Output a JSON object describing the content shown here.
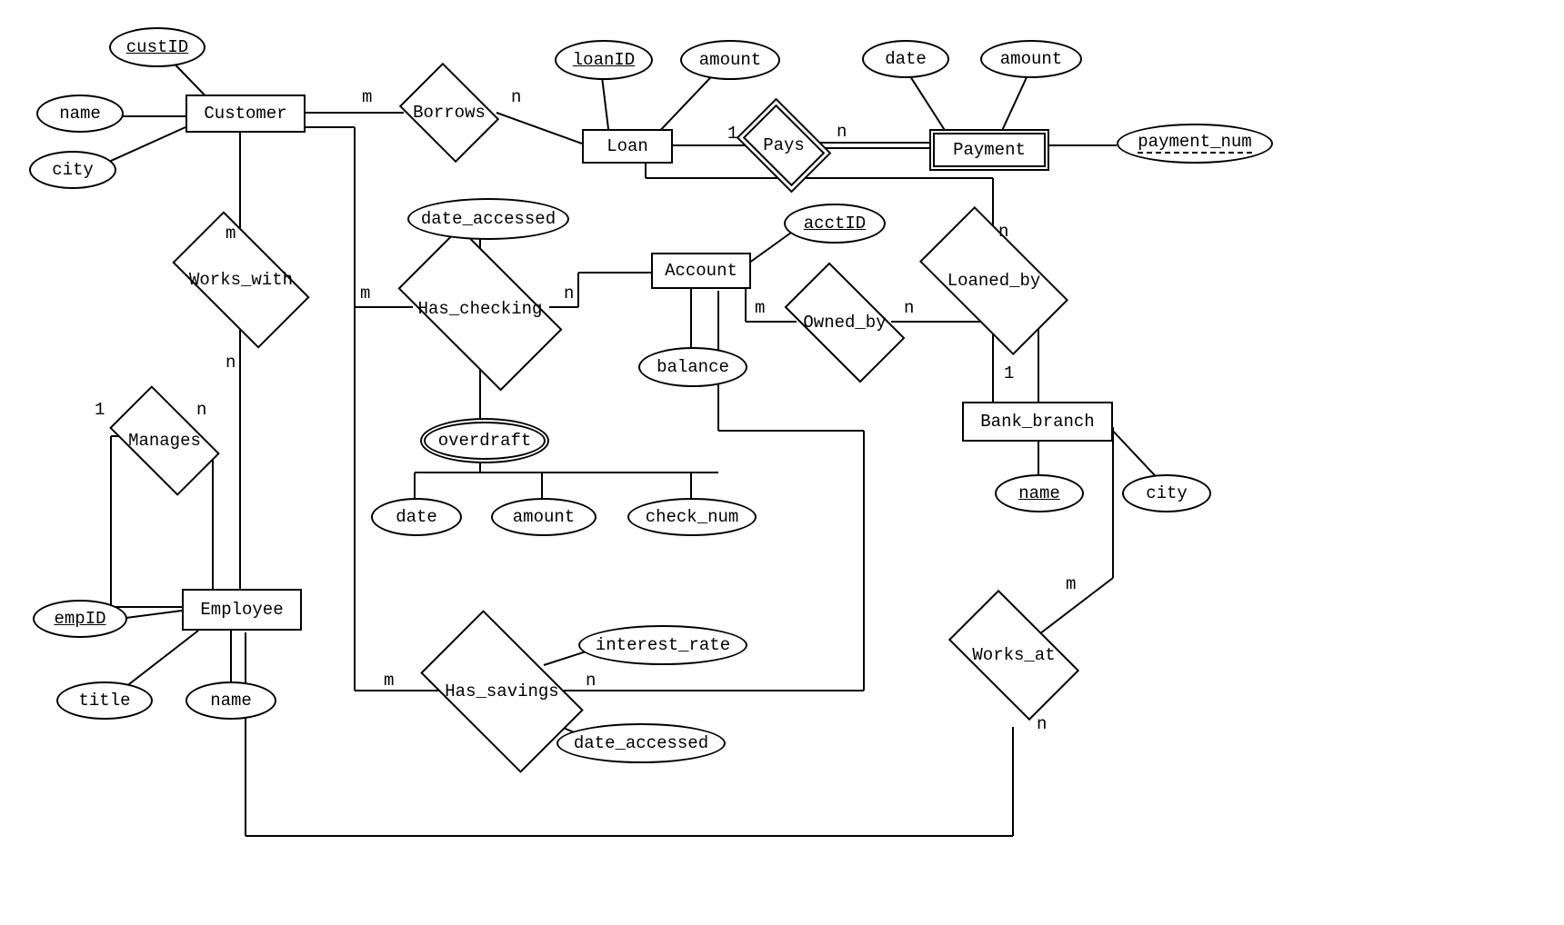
{
  "entities": {
    "customer": "Customer",
    "loan": "Loan",
    "payment": "Payment",
    "account": "Account",
    "bank_branch": "Bank_branch",
    "employee": "Employee"
  },
  "relationships": {
    "borrows": "Borrows",
    "pays": "Pays",
    "works_with": "Works_with",
    "has_checking": "Has_checking",
    "owned_by": "Owned_by",
    "loaned_by": "Loaned_by",
    "manages": "Manages",
    "has_savings": "Has_savings",
    "works_at": "Works_at"
  },
  "attributes": {
    "custID": "custID",
    "cust_name": "name",
    "cust_city": "city",
    "loanID": "loanID",
    "loan_amount": "amount",
    "pay_date": "date",
    "pay_amount": "amount",
    "payment_num": "payment_num",
    "checking_date_accessed": "date_accessed",
    "acctID": "acctID",
    "balance": "balance",
    "overdraft": "overdraft",
    "od_date": "date",
    "od_amount": "amount",
    "od_check_num": "check_num",
    "empID": "empID",
    "emp_title": "title",
    "emp_name": "name",
    "savings_interest": "interest_rate",
    "savings_date_accessed": "date_accessed",
    "branch_name": "name",
    "branch_city": "city"
  },
  "cardinalities": {
    "cust_borrows": "m",
    "borrows_loan": "n",
    "loan_pays": "1",
    "pays_payment": "n",
    "cust_works_with": "m",
    "works_with_emp": "n",
    "cust_checking": "m",
    "checking_acct": "n",
    "acct_owned": "m",
    "owned_branch": "n",
    "loan_loaned": "n",
    "loaned_branch": "1",
    "manages_sup": "1",
    "manages_sub": "n",
    "cust_savings": "m",
    "savings_acct": "n",
    "works_at_branch": "m",
    "works_at_emp": "n"
  }
}
